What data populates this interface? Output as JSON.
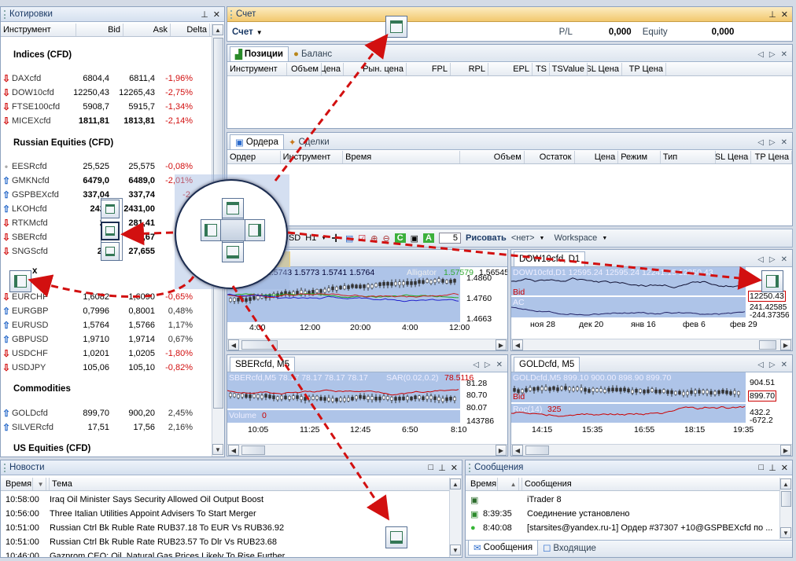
{
  "quotes": {
    "title": "Котировки",
    "cols": {
      "instrument": "Инструмент",
      "bid": "Bid",
      "ask": "Ask",
      "delta": "Delta"
    },
    "groups": [
      {
        "name": "Indices (CFD)"
      },
      {
        "name": "Russian Equities (CFD)"
      },
      {
        "name": "Commodities"
      },
      {
        "name": "US Equities (CFD)"
      }
    ],
    "rows": [
      {
        "dir": "down",
        "name": "DAXcfd",
        "bid": "6804,4",
        "ask": "6811,4",
        "delta": "-1,96%"
      },
      {
        "dir": "down",
        "name": "DOW10cfd",
        "bid": "12250,43",
        "ask": "12265,43",
        "delta": "-2,75%"
      },
      {
        "dir": "down",
        "name": "FTSE100cfd",
        "bid": "5908,7",
        "ask": "5915,7",
        "delta": "-1,34%"
      },
      {
        "dir": "down",
        "name": "MICEXcfd",
        "bid": "1811,81",
        "ask": "1813,81",
        "delta": "-2,14%"
      },
      {
        "dir": "flat",
        "name": "EESRcfd",
        "bid": "25,525",
        "ask": "25,575",
        "delta": "-0,08%"
      },
      {
        "dir": "up",
        "name": "GMKNcfd",
        "bid": "6479,0",
        "ask": "6489,0",
        "delta": "-2,01%"
      },
      {
        "dir": "up",
        "name": "GSPBEXcfd",
        "bid": "337,04",
        "ask": "337,74",
        "delta": "-2,"
      },
      {
        "dir": "up",
        "name": "LKOHcfd",
        "bid": "2429",
        "ask": "2431,00",
        "delta": ""
      },
      {
        "dir": "down",
        "name": "RTKMcfd",
        "bid": "28",
        "ask": "281,41",
        "delta": ""
      },
      {
        "dir": "down",
        "name": "SBERcfd",
        "bid": "7",
        "ask": "78,67",
        "delta": ""
      },
      {
        "dir": "down",
        "name": "SNGScfd",
        "bid": "27,",
        "ask": "27,655",
        "delta": ""
      },
      {
        "dir": "down",
        "name": "EURCHF",
        "bid": "1,6082",
        "ask": "1,6090",
        "delta": "-0,65%"
      },
      {
        "dir": "up",
        "name": "EURGBP",
        "bid": "0,7996",
        "ask": "0,8001",
        "delta": "0,48%"
      },
      {
        "dir": "up",
        "name": "EURUSD",
        "bid": "1,5764",
        "ask": "1,5766",
        "delta": "1,17%"
      },
      {
        "dir": "up",
        "name": "GBPUSD",
        "bid": "1,9710",
        "ask": "1,9714",
        "delta": "0,67%"
      },
      {
        "dir": "down",
        "name": "USDCHF",
        "bid": "1,0201",
        "ask": "1,0205",
        "delta": "-1,80%"
      },
      {
        "dir": "down",
        "name": "USDJPY",
        "bid": "105,06",
        "ask": "105,10",
        "delta": "-0,82%"
      },
      {
        "dir": "up",
        "name": "GOLDcfd",
        "bid": "899,70",
        "ask": "900,20",
        "delta": "2,45%"
      },
      {
        "dir": "up",
        "name": "SILVERcfd",
        "bid": "17,51",
        "ask": "17,56",
        "delta": "2,16%"
      }
    ],
    "partial_group_letter": "x"
  },
  "account": {
    "title": "Счет",
    "label": "Счет",
    "pl_label": "P/L",
    "pl_value": "0,000",
    "equity_label": "Equity",
    "equity_value": "0,000"
  },
  "positions": {
    "tabs": [
      "Позиции",
      "Баланс"
    ],
    "cols": [
      "Инструмент",
      "Объем",
      "Цена",
      "Рын. цена",
      "FPL",
      "RPL",
      "EPL",
      "TS",
      "TSValue",
      "SL Цена",
      "TP Цена"
    ]
  },
  "orders": {
    "tabs": [
      "Ордера",
      "Сделки"
    ],
    "cols": [
      "Ордер",
      "Инструмент",
      "Время",
      "Объем",
      "Остаток",
      "Цена",
      "Режим",
      "Тип",
      "SL Цена",
      "TP Цена"
    ]
  },
  "toolbar": {
    "symbol_partial": "USD",
    "period": "H1",
    "stepper_value": "5",
    "draw_label": "Рисовать",
    "none_label": "<нет>",
    "workspace_label": "Workspace"
  },
  "charts": {
    "c1": {
      "tab": "",
      "info": "1.5743  1.5773  1.5741  1.5764",
      "indicator": "Alligator",
      "ind_val": "1.57579",
      "ind_val2": "1.56545",
      "y": [
        "1.4860",
        "1.4760",
        "1.4663"
      ],
      "x": [
        "4:00",
        "12:00",
        "20:00",
        "4:00",
        "12:00"
      ]
    },
    "c2": {
      "tab": "DOW10cfd, D1",
      "info": "DOW10cfd,D1   12595.24  12595.24  12241.15  12250.43",
      "label_bid": "Bid",
      "label_ac": "AC",
      "price": "12250.43",
      "y_ac": [
        "241.42585",
        "-244.37356"
      ],
      "x": [
        "ноя 28",
        "дек 20",
        "янв 16",
        "фев 6",
        "фев 29"
      ]
    },
    "c3": {
      "tab": "SBERcfd, M5",
      "info": "SBERcfd,M5  78.17  78.17  78.17  78.17",
      "indicator": "SAR(0.02,0.2)",
      "ind_val": "78.5116",
      "y": [
        "81.28",
        "80.70",
        "80.07"
      ],
      "volume_label": "Volume",
      "volume_val": "0",
      "vol_y": "143786",
      "x": [
        "10:05",
        "11:25",
        "12:45",
        "6:50",
        "8:10"
      ]
    },
    "c4": {
      "tab": "GOLDcfd, M5",
      "info": "GOLDcfd,M5  899.10  900.00  898.90  899.70",
      "label_bid": "Bid",
      "price": "899.70",
      "y": [
        "904.51",
        "899.70"
      ],
      "roc_label": "Roc(14)",
      "roc_val": "325",
      "roc_y": [
        "432.2",
        "-672.2"
      ],
      "x": [
        "14:15",
        "15:35",
        "16:55",
        "18:15",
        "19:35"
      ]
    }
  },
  "news": {
    "title": "Новости",
    "cols": {
      "time": "Время",
      "topic": "Тема"
    },
    "rows": [
      {
        "time": "10:58:00",
        "topic": "Iraq Oil Minister Says Security Allowed Oil Output Boost"
      },
      {
        "time": "10:56:00",
        "topic": "Three Italian Utilities Appoint Advisers To Start Merger"
      },
      {
        "time": "10:51:00",
        "topic": "Russian Ctrl Bk Ruble Rate RUB37.18 To EUR Vs RUB36.92"
      },
      {
        "time": "10:51:00",
        "topic": "Russian Ctrl Bk Ruble Rate RUB23.57 To Dlr Vs RUB23.68"
      },
      {
        "time": "10:46:00",
        "topic": "Gazprom CEO: Oil, Natural Gas Prices Likely To Rise Further"
      }
    ]
  },
  "messages": {
    "title": "Сообщения",
    "cols": {
      "time": "Время",
      "msg": "Сообщения"
    },
    "rows": [
      {
        "time": "",
        "msg": "iTrader 8"
      },
      {
        "time": "8:39:35",
        "msg": "Соединение установлено"
      },
      {
        "time": "8:40:08",
        "msg": "[starsites@yandex.ru-1] Ордер #37307 +10@GSPBEXcfd по ..."
      }
    ],
    "tabs": [
      "Сообщения",
      "Входящие"
    ]
  },
  "colors": {
    "accent": "#d21010",
    "up": "#1f64c8",
    "head": "#d5e0ef",
    "chart_bg": "#aec4e8",
    "dock_arrow": "#d21010"
  }
}
